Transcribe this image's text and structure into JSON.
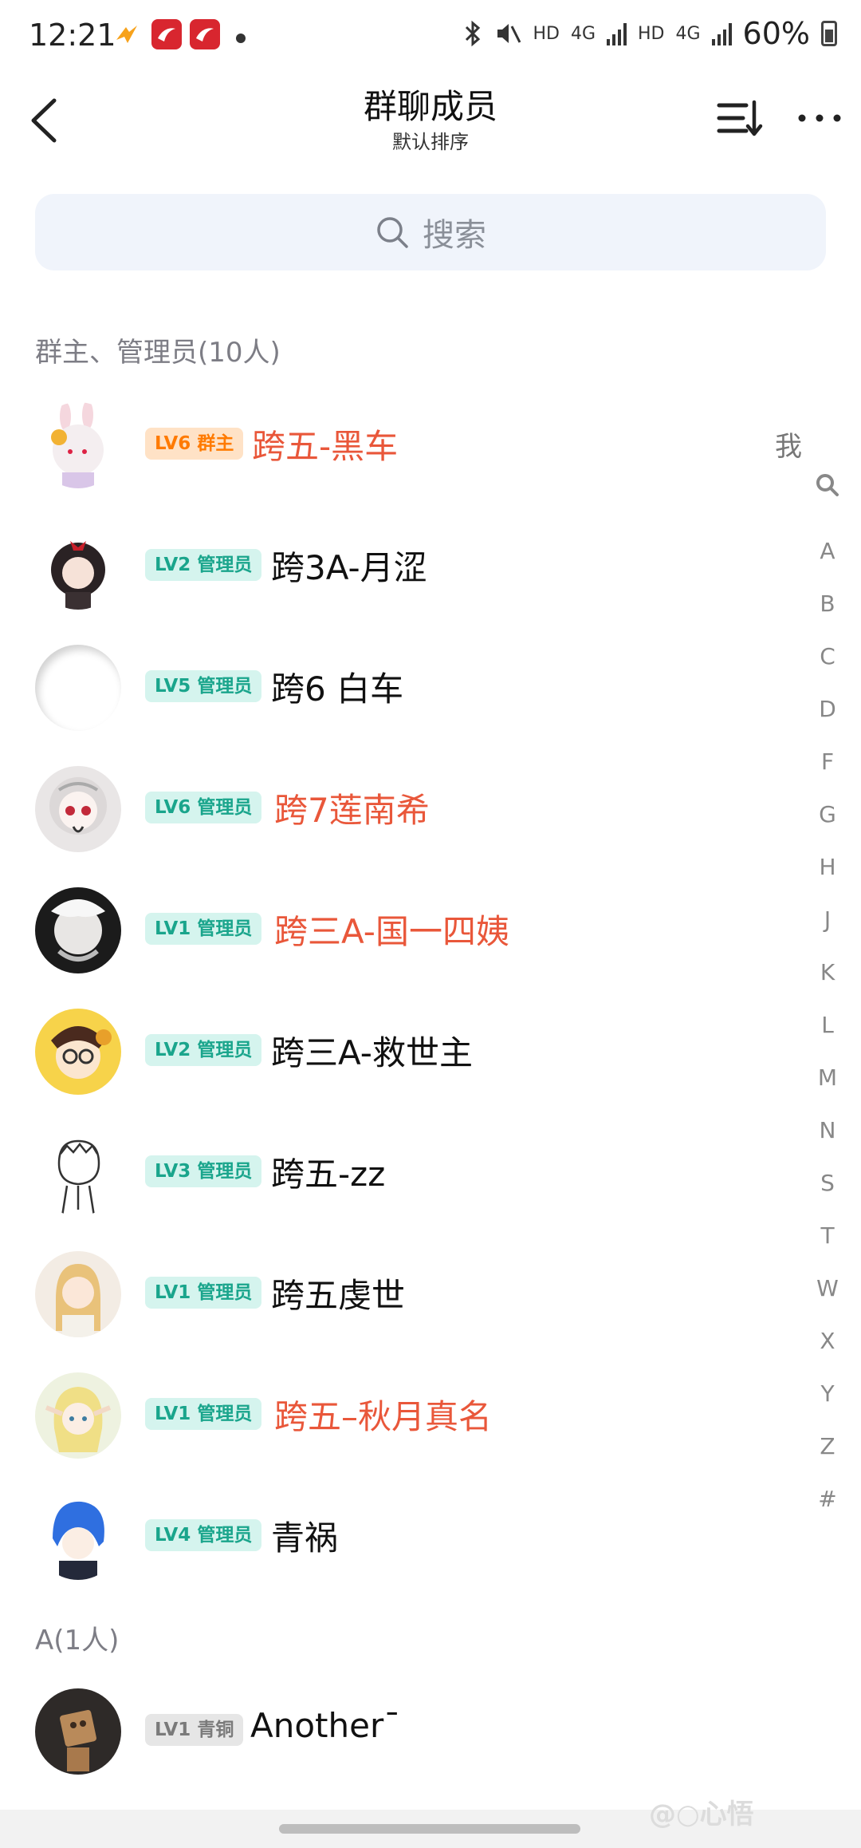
{
  "status": {
    "time": "12:21",
    "hd1": "HD",
    "net1": "4G",
    "hd2": "HD",
    "net2": "4G",
    "battery": "60%"
  },
  "header": {
    "title": "群聊成员",
    "subtitle": "默认排序"
  },
  "search": {
    "placeholder": "搜索"
  },
  "sections": {
    "admins": "群主、管理员(10人)",
    "a": "A(1人)"
  },
  "members": [
    {
      "level": "LV6",
      "role": "群主",
      "name": "跨五-黑车",
      "tag": "我"
    },
    {
      "level": "LV2",
      "role": "管理员",
      "name": "跨3A-月涩"
    },
    {
      "level": "LV5",
      "role": "管理员",
      "name": "跨6 白车"
    },
    {
      "level": "LV6",
      "role": "管理员",
      "name": "跨7莲南希"
    },
    {
      "level": "LV1",
      "role": "管理员",
      "name": "跨三A-国一四姨"
    },
    {
      "level": "LV2",
      "role": "管理员",
      "name": "跨三A-救世主"
    },
    {
      "level": "LV3",
      "role": "管理员",
      "name": "跨五-zz"
    },
    {
      "level": "LV1",
      "role": "管理员",
      "name": "跨五虔世"
    },
    {
      "level": "LV1",
      "role": "管理员",
      "name": "跨五–秋月真名"
    },
    {
      "level": "LV4",
      "role": "管理员",
      "name": "青祸"
    },
    {
      "level": "LV1",
      "role": "青铜",
      "name": "Another¯"
    }
  ],
  "index_letters": [
    "A",
    "B",
    "C",
    "D",
    "F",
    "G",
    "H",
    "J",
    "K",
    "L",
    "M",
    "N",
    "S",
    "T",
    "W",
    "X",
    "Y",
    "Z",
    "#"
  ],
  "watermark": "@○心悟",
  "colors": {
    "red_name": "#e9573a",
    "admin_badge": "#1aa58c",
    "owner_badge": "#ff7a00"
  }
}
